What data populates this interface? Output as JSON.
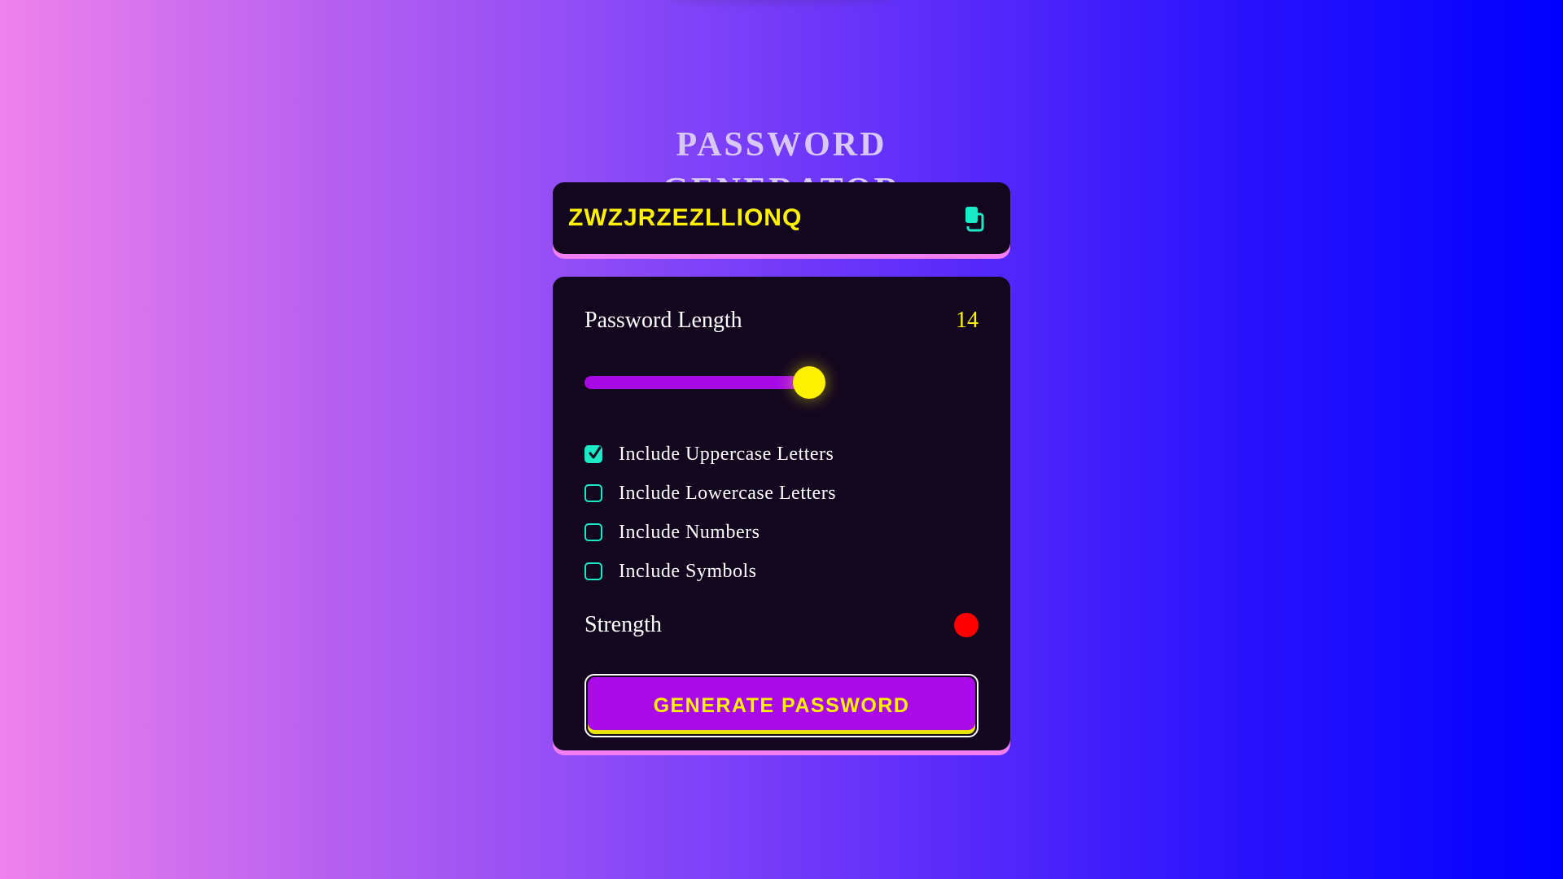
{
  "app": {
    "title": "PASSWORD GENERATOR"
  },
  "display": {
    "password": "ZWZJRZEZLLIONQ",
    "copy_icon": "copy-icon"
  },
  "length": {
    "label": "Password Length",
    "value": "14",
    "slider_fraction": 0.57
  },
  "options": [
    {
      "label": "Include Uppercase Letters",
      "checked": true
    },
    {
      "label": "Include Lowercase Letters",
      "checked": false
    },
    {
      "label": "Include Numbers",
      "checked": false
    },
    {
      "label": "Include Symbols",
      "checked": false
    }
  ],
  "strength": {
    "label": "Strength",
    "indicator_color": "#ff0000"
  },
  "generate": {
    "label": "GENERATE PASSWORD"
  },
  "colors": {
    "accent_yellow": "#fff200",
    "accent_teal": "#1de9c6",
    "accent_purple": "#aa0ae8",
    "panel_bg": "#13061f",
    "panel_shadow_pink": "#f27ff2"
  }
}
